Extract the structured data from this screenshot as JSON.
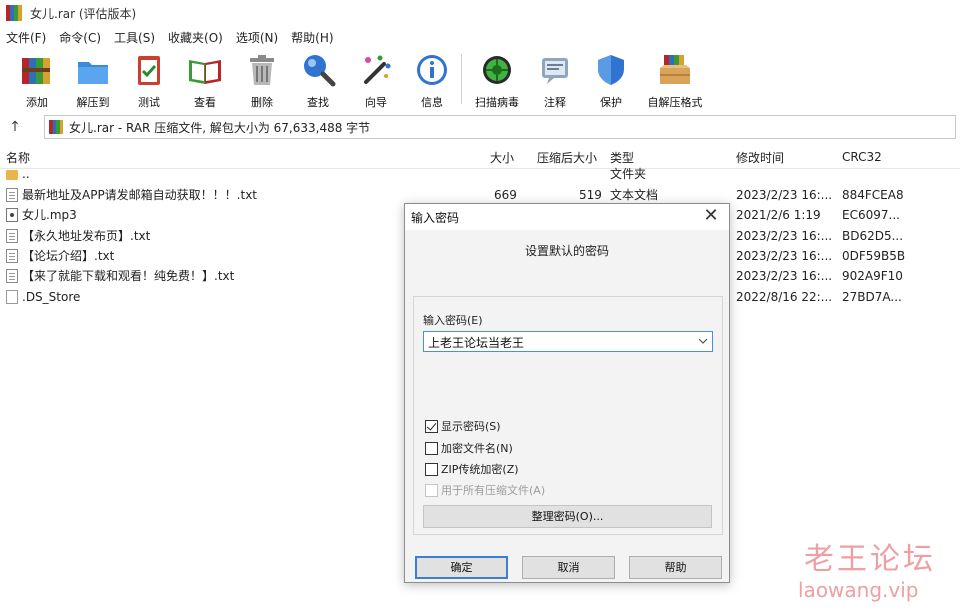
{
  "window": {
    "title": "女儿.rar (评估版本)",
    "icon": "winrar-books-icon"
  },
  "menu": [
    "文件(F)",
    "命令(C)",
    "工具(S)",
    "收藏夹(O)",
    "选项(N)",
    "帮助(H)"
  ],
  "toolbar": [
    {
      "label": "添加",
      "icon": "add-books-icon"
    },
    {
      "label": "解压到",
      "icon": "extract-folder-icon"
    },
    {
      "label": "测试",
      "icon": "test-clipboard-icon"
    },
    {
      "label": "查看",
      "icon": "view-book-icon"
    },
    {
      "label": "删除",
      "icon": "trash-icon"
    },
    {
      "label": "查找",
      "icon": "magnifier-icon"
    },
    {
      "label": "向导",
      "icon": "wizard-wand-icon"
    },
    {
      "label": "信息",
      "icon": "info-icon"
    },
    {
      "label": "扫描病毒",
      "icon": "virus-scan-icon"
    },
    {
      "label": "注释",
      "icon": "comment-icon"
    },
    {
      "label": "保护",
      "icon": "shield-icon"
    },
    {
      "label": "自解压格式",
      "icon": "sfx-box-icon"
    }
  ],
  "address": {
    "up": "↑",
    "text": "女儿.rar - RAR 压缩文件, 解包大小为 67,633,488 字节"
  },
  "columns": {
    "name": "名称",
    "size": "大小",
    "packed": "压缩后大小",
    "type": "类型",
    "modified": "修改时间",
    "crc": "CRC32"
  },
  "files": [
    {
      "name": "..",
      "size": "",
      "packed": "",
      "type": "文件夹",
      "modified": "",
      "crc": "",
      "icon": "folder-icon"
    },
    {
      "name": "最新地址及APP请发邮箱自动获取！！！.txt",
      "size": "669",
      "packed": "519",
      "type": "文本文档",
      "modified": "2023/2/23 16:...",
      "crc": "884FCEA8",
      "icon": "text-file-icon"
    },
    {
      "name": "女儿.mp3",
      "size": "",
      "packed": "",
      "type": "",
      "modified": "2021/2/6 1:19",
      "crc": "EC6097...",
      "icon": "audio-file-icon"
    },
    {
      "name": "【永久地址发布页】.txt",
      "size": "",
      "packed": "",
      "type": "",
      "modified": "2023/2/23 16:...",
      "crc": "BD62D5...",
      "icon": "text-file-icon"
    },
    {
      "name": "【论坛介绍】.txt",
      "size": "",
      "packed": "",
      "type": "",
      "modified": "2023/2/23 16:...",
      "crc": "0DF59B5B",
      "icon": "text-file-icon"
    },
    {
      "name": "【来了就能下载和观看！纯免费！】.txt",
      "size": "",
      "packed": "",
      "type": "",
      "modified": "2023/2/23 16:...",
      "crc": "902A9F10",
      "icon": "text-file-icon"
    },
    {
      "name": ".DS_Store",
      "size": "",
      "packed": "",
      "type": "",
      "modified": "2022/8/16 22:...",
      "crc": "27BD7A...",
      "icon": "blank-file-icon"
    }
  ],
  "dialog": {
    "title": "输入密码",
    "close": "✕",
    "subtitle": "设置默认的密码",
    "password_label": "输入密码(E)",
    "password_value": "上老王论坛当老王",
    "checkboxes": [
      {
        "label": "显示密码(S)",
        "checked": true,
        "disabled": false
      },
      {
        "label": "加密文件名(N)",
        "checked": false,
        "disabled": false
      },
      {
        "label": "ZIP传统加密(Z)",
        "checked": false,
        "disabled": false
      },
      {
        "label": "用于所有压缩文件(A)",
        "checked": false,
        "disabled": true
      }
    ],
    "organize_button": "整理密码(O)...",
    "ok": "确定",
    "cancel": "取消",
    "help": "帮助"
  },
  "watermark": {
    "line1": "老王论坛",
    "line2": "laowang.vip"
  },
  "colors": {
    "dialog_default_border": "#3c7fd1",
    "combo_focus": "#4a90d9",
    "watermark": "#e1505a"
  }
}
